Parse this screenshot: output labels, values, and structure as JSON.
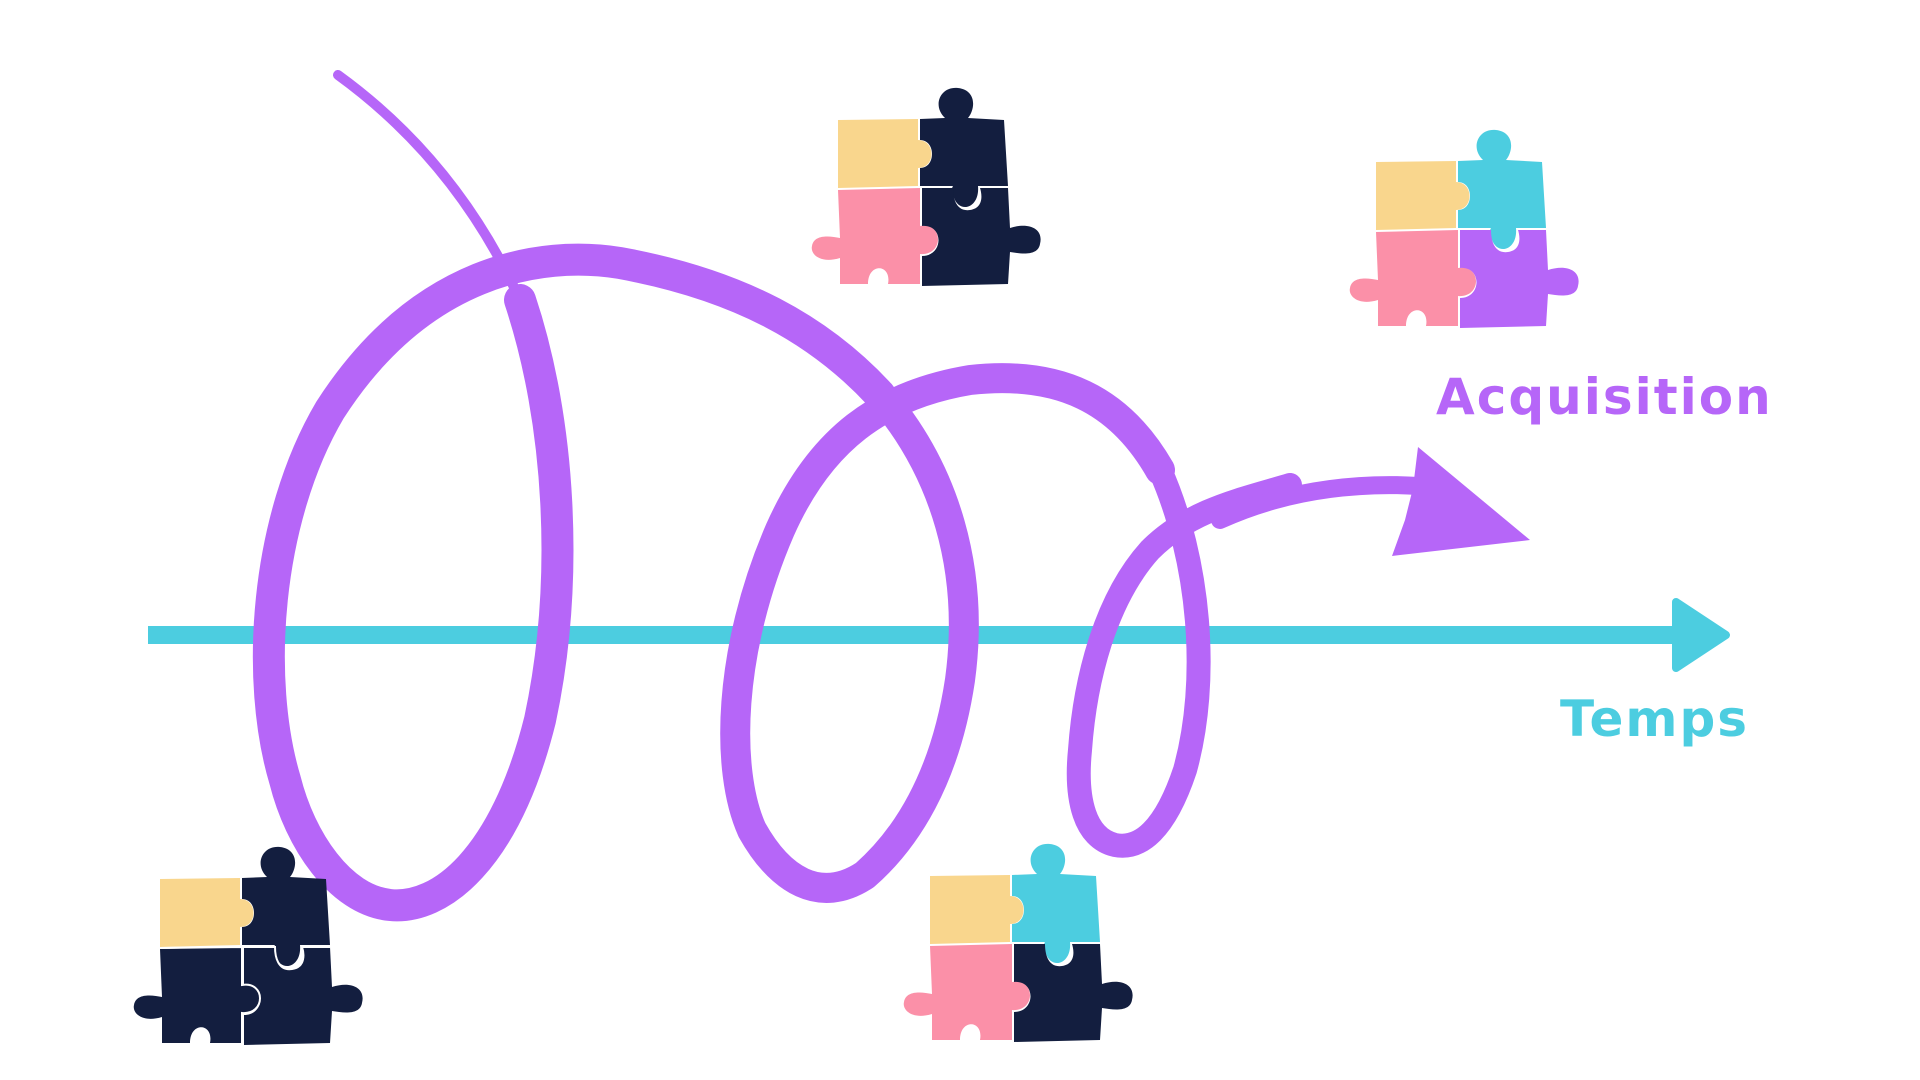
{
  "labels": {
    "acquisition": "Acquisition",
    "temps": "Temps"
  },
  "colors": {
    "spiral": "#b666f8",
    "timeline": "#4ccde0",
    "acquisition_label": "#b666f8",
    "temps_label": "#4ccde0",
    "piece_yellow": "#f9d68d",
    "piece_navy": "#131e3f",
    "piece_pink": "#fb90a8",
    "piece_cyan": "#4ccde0",
    "piece_purple": "#b666f8"
  },
  "puzzles": [
    {
      "name": "puzzle-top-center",
      "pieces": [
        "yellow",
        "navy",
        "pink",
        "navy"
      ]
    },
    {
      "name": "puzzle-top-right",
      "pieces": [
        "yellow",
        "cyan",
        "pink",
        "purple"
      ]
    },
    {
      "name": "puzzle-bottom-left",
      "pieces": [
        "yellow",
        "navy",
        "navy",
        "navy"
      ]
    },
    {
      "name": "puzzle-bottom-center",
      "pieces": [
        "yellow",
        "cyan",
        "pink",
        "navy"
      ]
    }
  ]
}
